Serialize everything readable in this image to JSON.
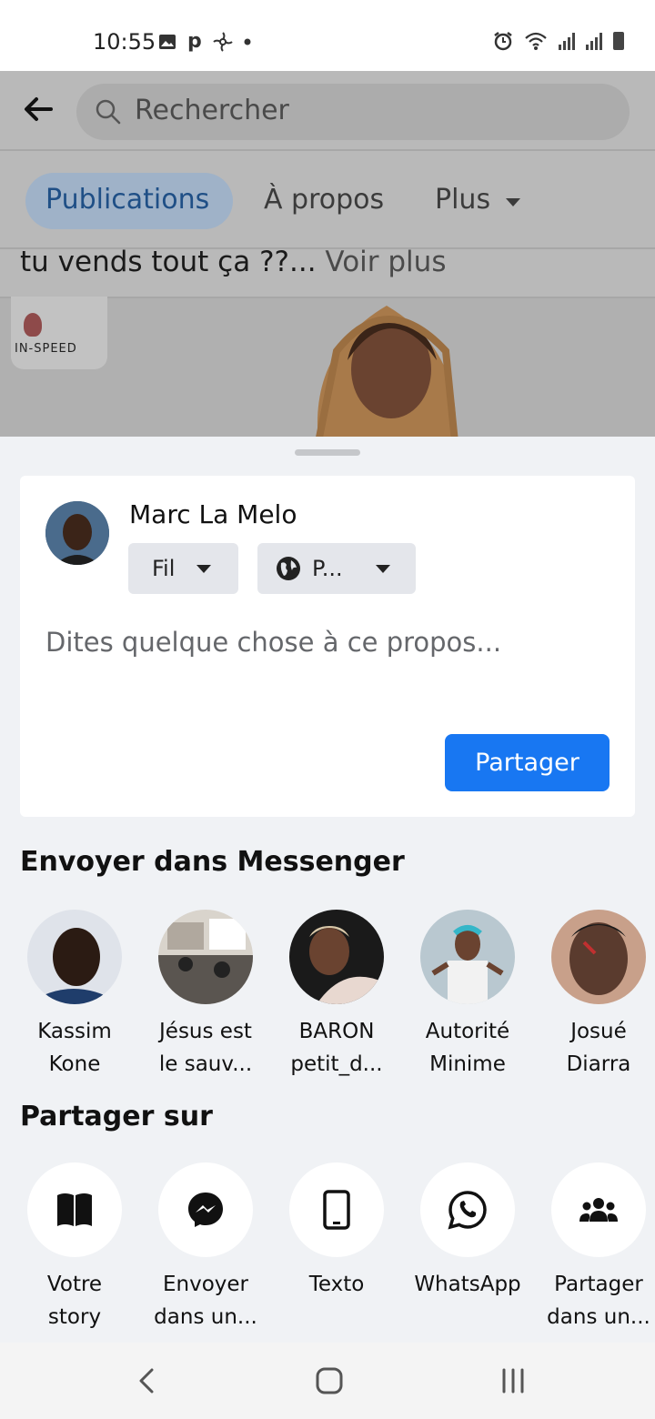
{
  "status_bar": {
    "time": "10:55",
    "left_icons": [
      "image-icon",
      "p-icon",
      "pinwheel-icon",
      "dot-icon"
    ],
    "right_icons": [
      "alarm-icon",
      "wifi-icon",
      "signal-icon",
      "signal-icon",
      "battery-icon"
    ]
  },
  "header": {
    "search_placeholder": "Rechercher"
  },
  "tabs": [
    {
      "label": "Publications",
      "active": true
    },
    {
      "label": "À propos",
      "active": false
    },
    {
      "label": "Plus",
      "active": false
    }
  ],
  "post": {
    "text": "tu vends tout ça ??...",
    "see_more": "Voir plus",
    "logo_text": "IN-SPEED"
  },
  "compose": {
    "user_name": "Marc La Melo",
    "destination": "Fil",
    "audience": "P...",
    "placeholder": "Dites quelque chose à ce propos...",
    "share_button": "Partager"
  },
  "messenger": {
    "title": "Envoyer dans Messenger",
    "contacts": [
      {
        "name_line1": "Kassim",
        "name_line2": "Kone",
        "avatar_color": "#1f3d6b"
      },
      {
        "name_line1": "Jésus est",
        "name_line2": "le sauv...",
        "avatar_color": "#d9d4cc"
      },
      {
        "name_line1": "BARON",
        "name_line2": "petit_d...",
        "avatar_color": "#2a2a2a"
      },
      {
        "name_line1": "Autorité",
        "name_line2": "Minime",
        "avatar_color": "#8fb7c9"
      },
      {
        "name_line1": "Josué",
        "name_line2": "Diarra",
        "avatar_color": "#5a3b2e"
      }
    ]
  },
  "share_on": {
    "title": "Partager sur",
    "options": [
      {
        "line1": "Votre",
        "line2": "story",
        "icon": "book-icon"
      },
      {
        "line1": "Envoyer",
        "line2": "dans un...",
        "icon": "messenger-icon"
      },
      {
        "line1": "Texto",
        "line2": "",
        "icon": "phone-icon"
      },
      {
        "line1": "WhatsApp",
        "line2": "",
        "icon": "whatsapp-icon"
      },
      {
        "line1": "Partager",
        "line2": "dans un...",
        "icon": "group-icon"
      }
    ]
  },
  "nav": {
    "buttons": [
      "back-nav-icon",
      "home-nav-icon",
      "recents-nav-icon"
    ]
  },
  "colors": {
    "accent": "#1877f2",
    "sheet_bg": "#f0f2f5",
    "dim_overlay": "#b9b9b9"
  }
}
